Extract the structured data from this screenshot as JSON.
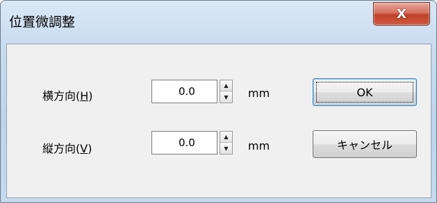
{
  "window": {
    "title": "位置微調整"
  },
  "icons": {
    "close": "close-icon",
    "spin_up": "spin-up-icon",
    "spin_down": "spin-down-icon"
  },
  "close_glyph": "X",
  "horizontal": {
    "label_prefix": "横方向(",
    "mnemonic": "H",
    "label_suffix": ")",
    "value": "0.0",
    "unit": "mm"
  },
  "vertical": {
    "label_prefix": "縦方向(",
    "mnemonic": "V",
    "label_suffix": ")",
    "value": "0.0",
    "unit": "mm"
  },
  "buttons": {
    "ok": "OK",
    "cancel": "キャンセル"
  },
  "colors": {
    "close_button": "#c0402a",
    "frame": "#c6d9ee",
    "client": "#f0f0f0"
  }
}
